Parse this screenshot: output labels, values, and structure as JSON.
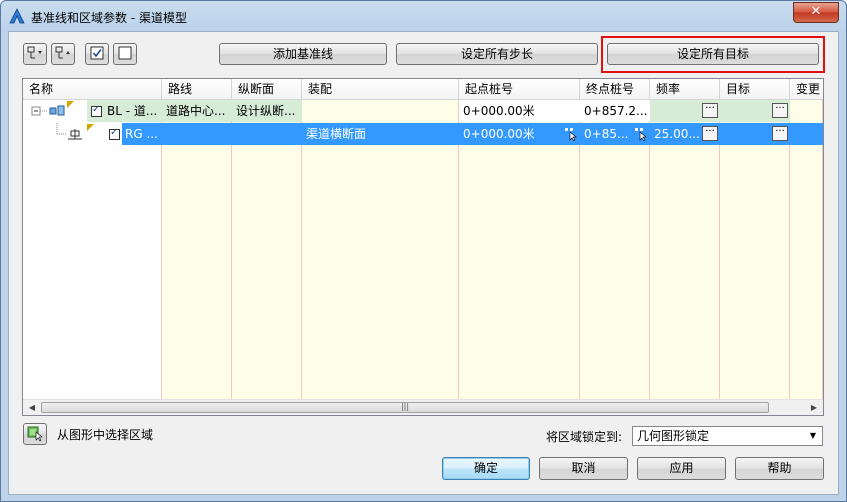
{
  "window": {
    "title": "基准线和区域参数 - 渠道模型",
    "close_label": "✕"
  },
  "toolbar": {
    "add_baseline_label": "添加基准线",
    "set_all_frequencies_label": "设定所有步长",
    "set_all_targets_label": "设定所有目标"
  },
  "table": {
    "headers": [
      "名称",
      "路线",
      "纵断面",
      "装配",
      "起点桩号",
      "终点桩号",
      "频率",
      "目标",
      "变更"
    ],
    "rows": [
      {
        "name": "BL - 道...",
        "alignment": "道路中心...",
        "profile": "设计纵断...",
        "assembly": "",
        "start_station": "0+000.00米",
        "end_station": "0+857.2...",
        "frequency": "",
        "target": ""
      },
      {
        "name": "RG ...",
        "alignment": "",
        "profile": "",
        "assembly": "渠道横断面",
        "start_station": "0+000.00米",
        "end_station": "0+85...",
        "frequency": "25.00...",
        "target": ""
      }
    ],
    "ellipsis": "···"
  },
  "select_region": {
    "label": "从图形中选择区域"
  },
  "lock_region": {
    "label": "将区域锁定到:",
    "value": "几何图形锁定"
  },
  "buttons": {
    "ok": "确定",
    "cancel": "取消",
    "apply": "应用",
    "help": "帮助"
  },
  "colors": {
    "selection": "#3399ff",
    "highlight_border": "#e01010",
    "cell_background": "#fefde8"
  }
}
